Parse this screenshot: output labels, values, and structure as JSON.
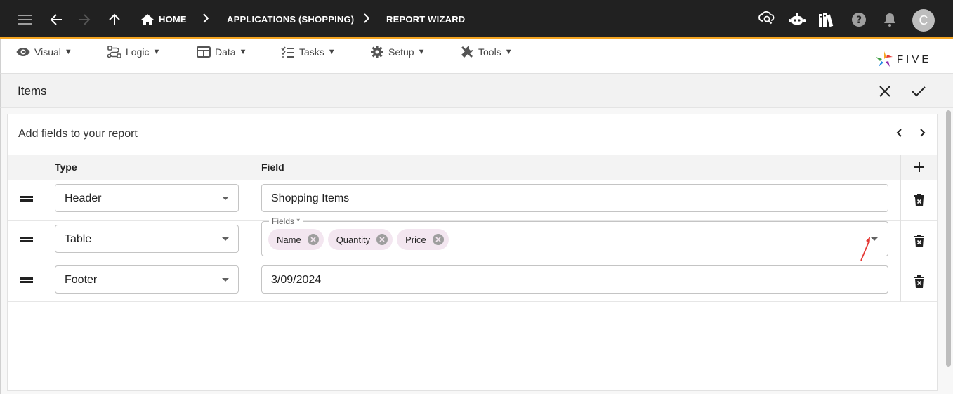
{
  "topbar": {
    "breadcrumbs": [
      "HOME",
      "APPLICATIONS (SHOPPING)",
      "REPORT WIZARD"
    ],
    "avatar_initial": "C",
    "icons": [
      "menu-icon",
      "back-arrow-icon",
      "forward-arrow-icon",
      "up-arrow-icon",
      "home-icon",
      "cloud-search-icon",
      "chatbot-icon",
      "library-icon",
      "help-icon",
      "bell-icon"
    ]
  },
  "menubar": {
    "items": [
      {
        "label": "Visual",
        "icon": "eye-icon"
      },
      {
        "label": "Logic",
        "icon": "logic-flow-icon"
      },
      {
        "label": "Data",
        "icon": "table-grid-icon"
      },
      {
        "label": "Tasks",
        "icon": "checklist-icon"
      },
      {
        "label": "Setup",
        "icon": "gear-icon"
      },
      {
        "label": "Tools",
        "icon": "tools-icon"
      }
    ],
    "caret": "▼",
    "logo_text": "FIVE"
  },
  "items_header": {
    "title": "Items"
  },
  "panel": {
    "title": "Add fields to your report",
    "columns": {
      "type": "Type",
      "field": "Field"
    },
    "rows": [
      {
        "type": "Header",
        "field_value": "Shopping Items"
      },
      {
        "type": "Table",
        "field_legend": "Fields *",
        "chips": [
          "Name",
          "Quantity",
          "Price"
        ]
      },
      {
        "type": "Footer",
        "field_value": "3/09/2024"
      }
    ]
  },
  "colors": {
    "topbar_bg": "#212121",
    "accent_orange": "#f5a623",
    "chip_bg": "#f3e6f0",
    "annotation_red": "#e53935"
  }
}
